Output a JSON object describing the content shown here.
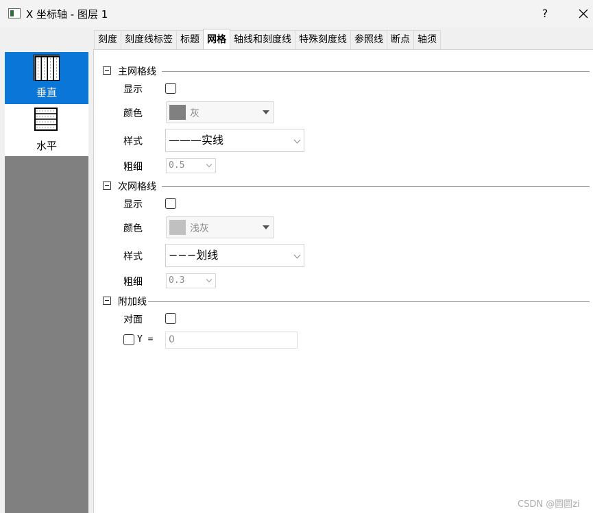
{
  "window": {
    "title": "X 坐标轴 - 图层 1",
    "help_label": "?",
    "close_label": "✕"
  },
  "left_panel": {
    "items": [
      {
        "label": "垂直",
        "icon": "vertical-grid-icon",
        "selected": true
      },
      {
        "label": "水平",
        "icon": "horizontal-grid-icon",
        "selected": false
      }
    ]
  },
  "tabs": [
    {
      "label": "刻度"
    },
    {
      "label": "刻度线标签"
    },
    {
      "label": "标题"
    },
    {
      "label": "网格",
      "active": true
    },
    {
      "label": "轴线和刻度线"
    },
    {
      "label": "特殊刻度线"
    },
    {
      "label": "参照线"
    },
    {
      "label": "断点"
    },
    {
      "label": "轴须"
    }
  ],
  "major_grid": {
    "section_label": "主网格线",
    "show_label": "显示",
    "show_checked": false,
    "color_label": "颜色",
    "color_value": "灰",
    "color_swatch": "#808080",
    "style_label": "样式",
    "style_value": "———实线",
    "width_label": "粗细",
    "width_value": "0.5"
  },
  "minor_grid": {
    "section_label": "次网格线",
    "show_label": "显示",
    "show_checked": false,
    "color_label": "颜色",
    "color_value": "浅灰",
    "color_swatch": "#c0c0c0",
    "style_label": "样式",
    "style_value": "−−−划线",
    "width_label": "粗细",
    "width_value": "0.3"
  },
  "additional_lines": {
    "section_label": "附加线",
    "opposite_label": "对面",
    "opposite_checked": false,
    "y_label": "Y =",
    "y_checked": false,
    "y_value": "0"
  },
  "watermark": "CSDN @圆圆zi",
  "colors": {
    "selected_blue": "#0a77d8",
    "panel_gray": "#808080"
  }
}
